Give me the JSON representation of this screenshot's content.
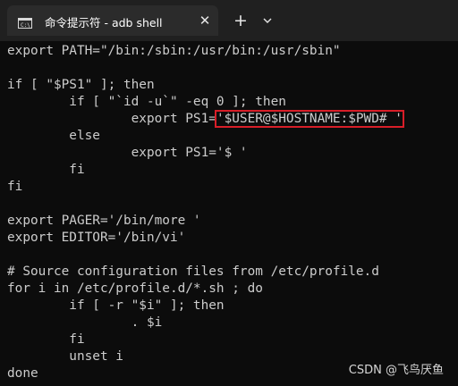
{
  "window": {
    "tab_title": "命令提示符 - adb  shell",
    "close_glyph": "✕",
    "new_tab_glyph": "+",
    "dropdown_icon": "chevron-down-icon",
    "colors": {
      "titlebar": "#202020",
      "tab": "#2b2b2b",
      "terminal_bg": "#0c0c0c",
      "terminal_text": "#cccccc",
      "highlight_box": "#d81e28"
    }
  },
  "terminal": {
    "lines": [
      "export PATH=\"/bin:/sbin:/usr/bin:/usr/sbin\"",
      "",
      "if [ \"$PS1\" ]; then",
      "        if [ \"`id -u`\" -eq 0 ]; then",
      "                export PS1=",
      "        else",
      "                export PS1='$ '",
      "        fi",
      "fi",
      "",
      "export PAGER='/bin/more '",
      "export EDITOR='/bin/vi'",
      "",
      "# Source configuration files from /etc/profile.d",
      "for i in /etc/profile.d/*.sh ; do",
      "        if [ -r \"$i\" ]; then",
      "                . $i",
      "        fi",
      "        unset i",
      "done"
    ],
    "highlighted_text": "'$USER@$HOSTNAME:$PWD# '"
  },
  "watermark": "CSDN @飞鸟厌鱼"
}
